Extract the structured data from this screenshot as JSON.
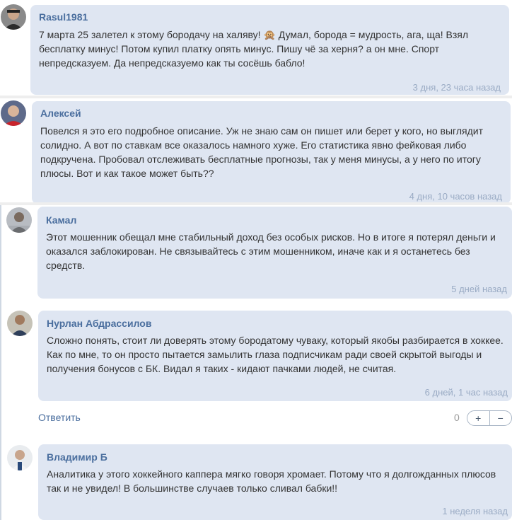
{
  "comments": [
    {
      "author": "Rasul1981",
      "text_before": "7 марта 25 залетел к этому бородачу на халяву! ",
      "text_after": " Думал, борода = мудрость, ага, ща! Взял бесплатку минус! Потом купил платку опять минус. Пишу чё за херня? а он мне. Спорт непредсказуем. Да непредсказуемо как ты сосёшь бабло!",
      "emoji": "🙊",
      "time": "3 дня, 23 часа назад"
    },
    {
      "author": "Алексей",
      "text": "Повелся я это его подробное описание. Уж не знаю сам он пишет или берет у кого, но выглядит солидно. А вот по ставкам все оказалось намного хуже. Его статистика явно фейковая либо подкручена. Пробовал отслеживать бесплатные прогнозы, так у меня минусы, а у него по итогу плюсы. Вот и как такое может быть??",
      "time": "4 дня, 10 часов назад"
    },
    {
      "author": "Камал",
      "text": "Этот мошенник обещал мне стабильный доход без особых рисков. Но в итоге я потерял деньги и оказался заблокирован. Не связывайтесь с этим мошенником, иначе как и я останетесь без средств.",
      "time": "5 дней назад"
    },
    {
      "author": "Нурлан Абдрассилов",
      "text": "Сложно понять, стоит ли доверять этому бородатому чуваку, который якобы разбирается в хоккее. Как по мне, то он просто пытается замылить глаза подписчикам ради своей скрытой выгоды и получения бонусов с БК. Видал я таких - кидают пачками людей, не считая.",
      "time": "6 дней, 1 час назад"
    },
    {
      "author": "Владимир Б",
      "text": "Аналитика у этого хоккейного каппера мягко говоря хромает. Потому что я долгожданных плюсов так и не увидел! В большинстве случаев только сливал бабки!!",
      "time": "1 неделя назад"
    }
  ],
  "actions": {
    "reply_label": "Ответить",
    "vote_count": "0",
    "upvote_label": "+",
    "downvote_label": "−"
  },
  "colors": {
    "bubble": "#dfe6f2",
    "author": "#4a6e9e",
    "timestamp": "#9aabc4",
    "text": "#333333"
  },
  "icons": [
    "avatar",
    "monkey-emoji-icon",
    "plus-icon",
    "minus-icon"
  ]
}
